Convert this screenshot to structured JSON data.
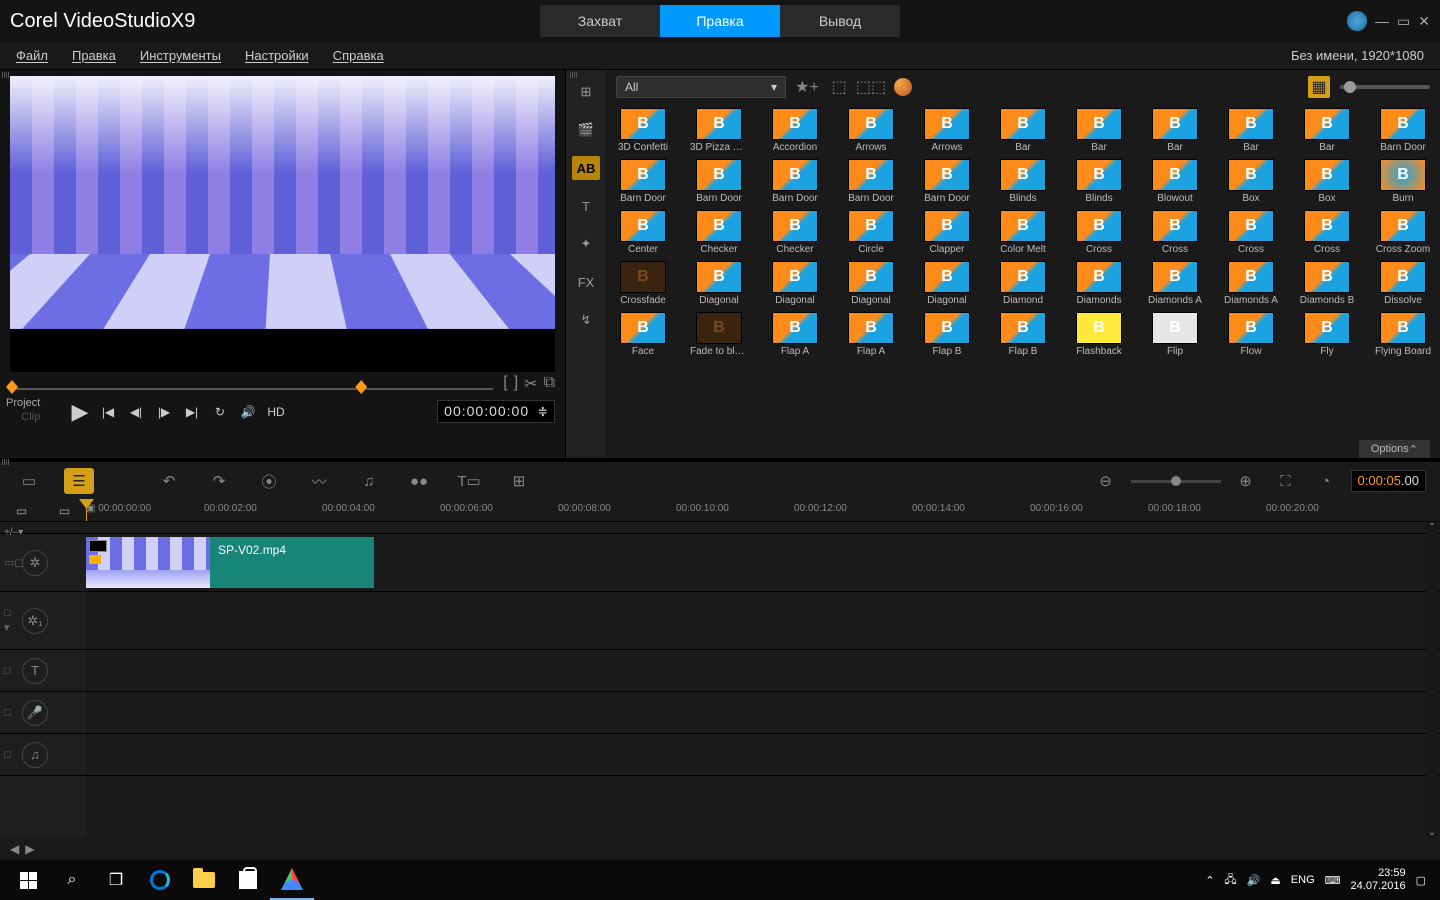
{
  "brand": {
    "corel": "Corel",
    "vs": "VideoStudio",
    "x9": "X9"
  },
  "tabs": {
    "capture": "Захват",
    "edit": "Правка",
    "output": "Вывод"
  },
  "menu": {
    "file": "Файл",
    "edit": "Правка",
    "tools": "Инструменты",
    "settings": "Настройки",
    "help": "Справка"
  },
  "project_info": "Без имени, 1920*1080",
  "preview": {
    "project": "Project",
    "clip": "Clip",
    "hd": "HD",
    "tc": "00:00:00:00"
  },
  "library": {
    "filter": "All",
    "options": "Options",
    "side": [
      "⊞",
      "🎬",
      "AB",
      "T",
      "✦",
      "FX",
      "↯"
    ],
    "rows": [
      [
        "3D Confetti",
        "3D Pizza Bo…",
        "Accordion",
        "Arrows",
        "Arrows",
        "Bar",
        "Bar",
        "Bar",
        "Bar",
        "Bar",
        "Barn Door"
      ],
      [
        "Barn Door",
        "Barn Door",
        "Barn Door",
        "Barn Door",
        "Barn Door",
        "Blinds",
        "Blinds",
        "Blowout",
        "Box",
        "Box",
        "Burn"
      ],
      [
        "Center",
        "Checker",
        "Checker",
        "Circle",
        "Clapper",
        "Color Melt",
        "Cross",
        "Cross",
        "Cross",
        "Cross",
        "Cross Zoom"
      ],
      [
        "Crossfade",
        "Diagonal",
        "Diagonal",
        "Diagonal",
        "Diagonal",
        "Diamond",
        "Diamonds",
        "Diamonds A",
        "Diamonds A",
        "Diamonds B",
        "Dissolve"
      ],
      [
        "Face",
        "Fade to black",
        "Flap A",
        "Flap A",
        "Flap B",
        "Flap B",
        "Flashback",
        "Flip",
        "Flow",
        "Fly",
        "Flying Board"
      ]
    ]
  },
  "timeline": {
    "duration": "0:00:05",
    "duration_frac": ".00",
    "ruler": [
      "00:00:00:00",
      "00:00:02:00",
      "00:00:04:00",
      "00:00:06:00",
      "00:00:08:00",
      "00:00:10:00",
      "00:00:12:00",
      "00:00:14:00",
      "00:00:16:00",
      "00:00:18:00",
      "00:00:20:00"
    ],
    "clip_name": "SP-V02.mp4"
  },
  "taskbar": {
    "lang": "ENG",
    "time": "23:59",
    "date": "24.07.2016"
  }
}
